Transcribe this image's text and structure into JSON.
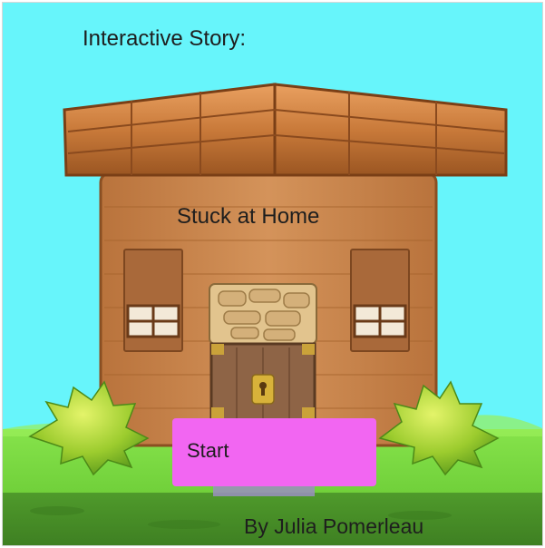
{
  "story": {
    "heading": "Interactive Story:",
    "title": "Stuck at Home",
    "author_line": "By Julia Pomerleau"
  },
  "controls": {
    "start_label": "Start"
  },
  "scene": {
    "sky_color": "#67f5fb",
    "grass_color": "#72d63a",
    "wood_color": "#c9884d",
    "button_color": "#f266f2"
  }
}
